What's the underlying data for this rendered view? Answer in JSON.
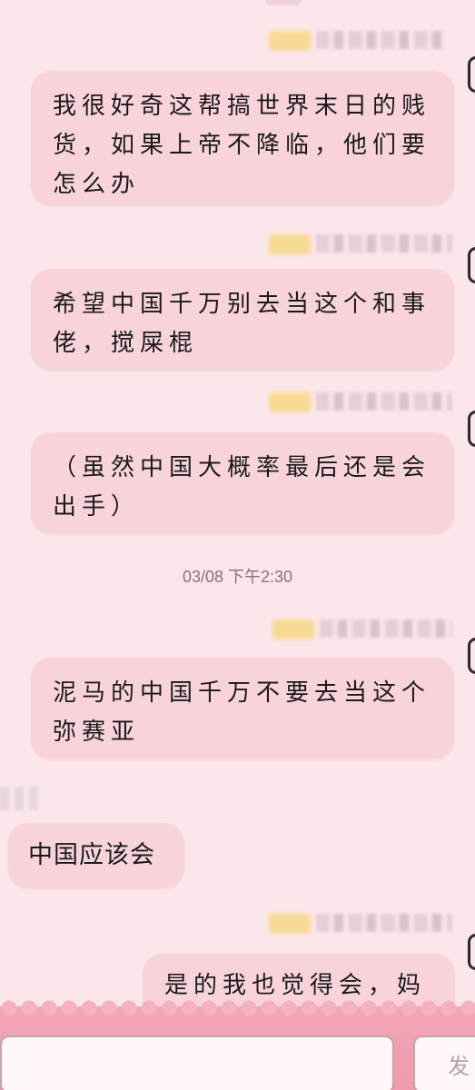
{
  "messages": [
    {
      "text": "我很好奇这帮搞世界末日的贱货，如果上帝不降临，他们要怎么办",
      "side": "right"
    },
    {
      "text": "希望中国千万别去当这个和事佬，搅屎棍",
      "side": "right"
    },
    {
      "text": "（虽然中国大概率最后还是会出手）",
      "side": "right"
    },
    {
      "text": "泥马的中国千万不要去当这个弥赛亚",
      "side": "right"
    },
    {
      "text": "中国应该会",
      "side": "left"
    },
    {
      "text": "是的我也觉得会，妈的",
      "side": "right"
    }
  ],
  "timestamp": "03/08 下午2:30",
  "composer": {
    "send_label": "发"
  },
  "colors": {
    "background": "#fbe6ea",
    "bubble": "#f8d4da",
    "bottom_bar": "#ef9bac"
  }
}
